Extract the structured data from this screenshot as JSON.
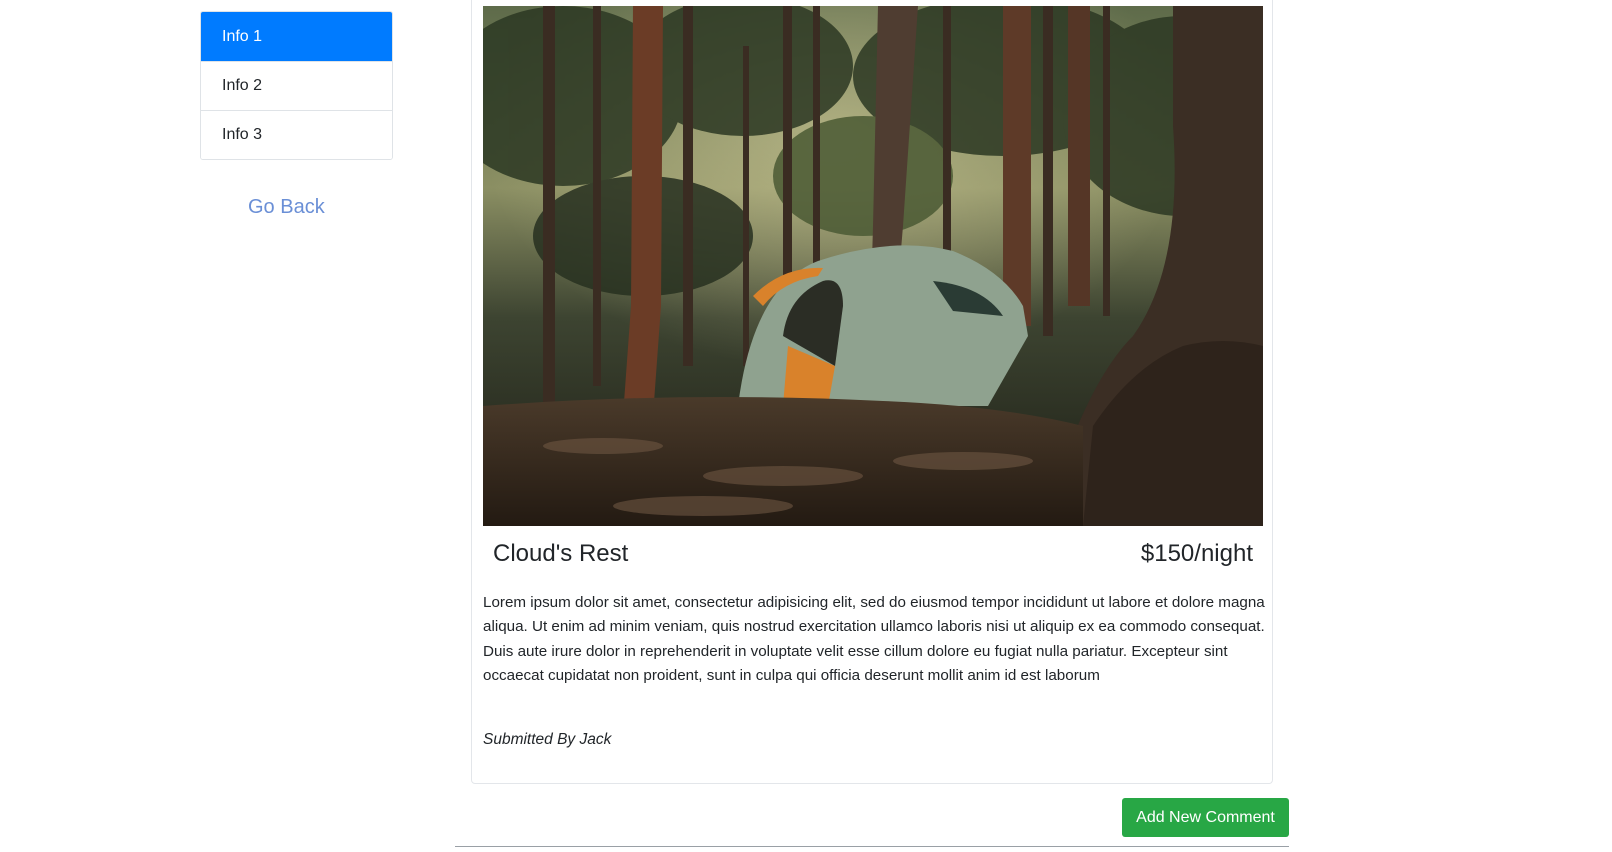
{
  "sidebar": {
    "items": [
      {
        "label": "Info 1",
        "active": true
      },
      {
        "label": "Info 2",
        "active": false
      },
      {
        "label": "Info 3",
        "active": false
      }
    ],
    "go_back": "Go Back"
  },
  "campground": {
    "name": "Cloud's Rest",
    "price": "$150/night",
    "description": "Lorem ipsum dolor sit amet, consectetur adipisicing elit, sed do eiusmod tempor incididunt ut labore et dolore magna aliqua. Ut enim ad minim veniam, quis nostrud exercitation ullamco laboris nisi ut aliquip ex ea commodo consequat. Duis aute irure dolor in reprehenderit in voluptate velit esse cillum dolore eu fugiat nulla pariatur. Excepteur sint occaecat cupidatat non proident, sunt in culpa qui officia deserunt mollit anim id est laborum",
    "submitted_prefix": "Submitted By",
    "author": "Jack"
  },
  "actions": {
    "add_comment": "Add New Comment"
  },
  "colors": {
    "primary": "#007bff",
    "success": "#28a745",
    "link": "#6a8fd6"
  }
}
